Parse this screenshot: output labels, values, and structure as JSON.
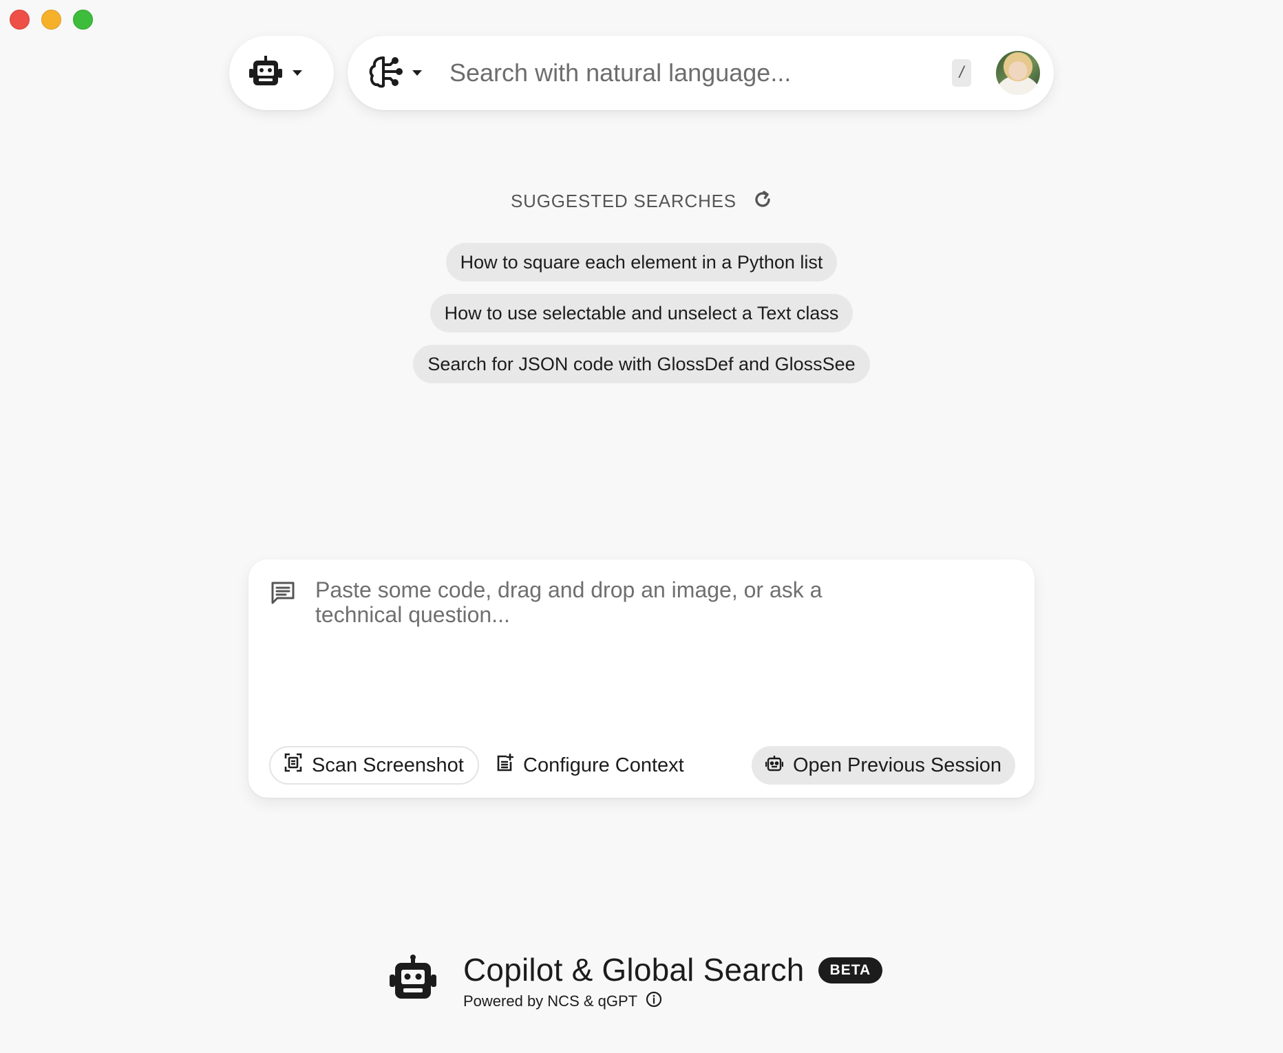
{
  "window": {
    "controls": [
      "close",
      "minimize",
      "maximize"
    ]
  },
  "topbar": {
    "model_icon": "robot-icon",
    "search_mode_icon": "brain-circuit-icon",
    "search_placeholder": "Search with natural language...",
    "shortcut_key": "/",
    "avatar": "user-avatar"
  },
  "suggested": {
    "title": "SUGGESTED SEARCHES",
    "refresh_icon": "refresh-icon",
    "items": [
      "How to square each element in a Python list",
      "How to use selectable and unselect a Text class",
      "Search for JSON code with GlossDef and GlossSee"
    ]
  },
  "composer": {
    "icon": "chat-icon",
    "placeholder": "Paste some code, drag and drop an image, or ask a technical question...",
    "buttons": {
      "scan": "Scan Screenshot",
      "configure": "Configure Context",
      "previous": "Open Previous Session"
    }
  },
  "footer": {
    "title": "Copilot & Global Search",
    "badge": "BETA",
    "subtitle": "Powered by NCS & qGPT",
    "info_icon": "info-icon"
  },
  "colors": {
    "background": "#f8f8f8",
    "text": "#1c1c1c",
    "chip": "#e8e8e8",
    "close": "#ee4f47",
    "minimize": "#f6b12b",
    "maximize": "#3ebd3c"
  }
}
